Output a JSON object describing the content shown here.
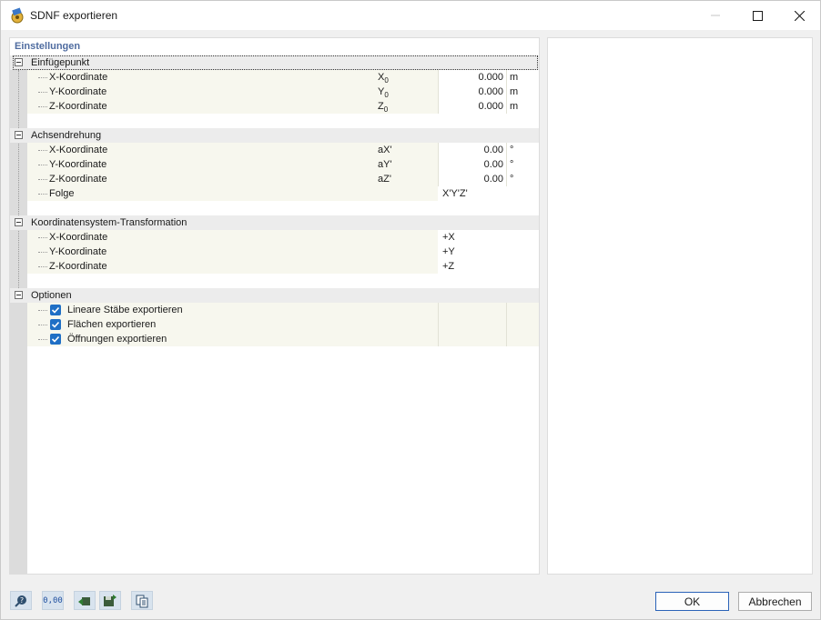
{
  "window": {
    "title": "SDNF exportieren"
  },
  "panel": {
    "title": "Einstellungen"
  },
  "groups": {
    "insert": {
      "label": "Einfügepunkt",
      "items": [
        {
          "label": "X-Koordinate",
          "symbol": "X0",
          "value": "0.000",
          "unit": "m"
        },
        {
          "label": "Y-Koordinate",
          "symbol": "Y0",
          "value": "0.000",
          "unit": "m"
        },
        {
          "label": "Z-Koordinate",
          "symbol": "Z0",
          "value": "0.000",
          "unit": "m"
        }
      ]
    },
    "rotation": {
      "label": "Achsendrehung",
      "items": [
        {
          "label": "X-Koordinate",
          "symbol": "aX'",
          "value": "0.00",
          "unit": "°"
        },
        {
          "label": "Y-Koordinate",
          "symbol": "aY'",
          "value": "0.00",
          "unit": "°"
        },
        {
          "label": "Z-Koordinate",
          "symbol": "aZ'",
          "value": "0.00",
          "unit": "°"
        }
      ],
      "sequence": {
        "label": "Folge",
        "value": "X'Y'Z'"
      }
    },
    "transform": {
      "label": "Koordinatensystem-Transformation",
      "items": [
        {
          "label": "X-Koordinate",
          "value": "+X"
        },
        {
          "label": "Y-Koordinate",
          "value": "+Y"
        },
        {
          "label": "Z-Koordinate",
          "value": "+Z"
        }
      ]
    },
    "options": {
      "label": "Optionen",
      "items": [
        {
          "label": "Lineare Stäbe exportieren",
          "checked": true
        },
        {
          "label": "Flächen exportieren",
          "checked": true
        },
        {
          "label": "Öffnungen exportieren",
          "checked": true
        }
      ]
    }
  },
  "toolbar": {
    "units_value": "0,00"
  },
  "buttons": {
    "ok": "OK",
    "cancel": "Abbrechen"
  },
  "colors": {
    "accent": "#1f6fc5",
    "panel_title": "#4f6ca0",
    "row_bg": "#f7f7ee"
  }
}
